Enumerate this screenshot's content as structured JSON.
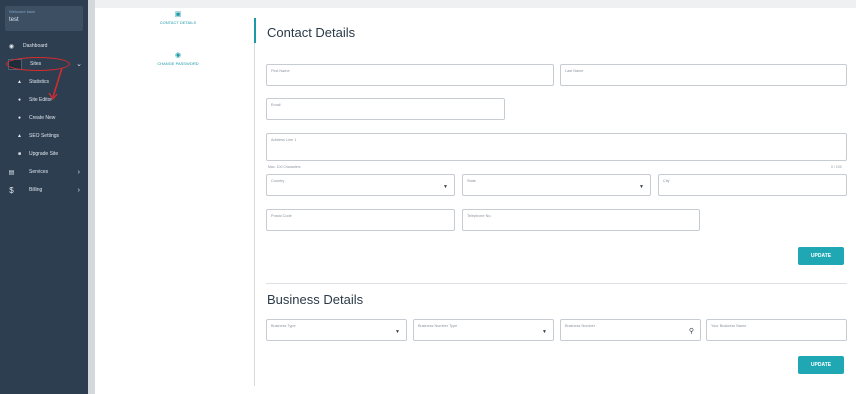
{
  "sidebar": {
    "user_label": "Welcome back",
    "user_name": "test",
    "items": [
      {
        "label": "Dashboard",
        "icon": "palette-icon"
      },
      {
        "label": "Sites",
        "icon": "window-icon"
      },
      {
        "label": "Statistics",
        "icon": "chart-icon"
      },
      {
        "label": "Site Editor",
        "icon": "edit-icon"
      },
      {
        "label": "Create New",
        "icon": "plus-icon"
      },
      {
        "label": "SEO Settings",
        "icon": "seo-icon"
      },
      {
        "label": "Upgrade Site",
        "icon": "upgrade-icon"
      },
      {
        "label": "Services",
        "icon": "server-icon"
      },
      {
        "label": "Billing",
        "icon": "dollar-icon"
      }
    ]
  },
  "tabs": {
    "contact": "CONTACT DETAILS",
    "password": "CHANGE PASSWORD"
  },
  "contact": {
    "title": "Contact Details",
    "first_name": "First Name",
    "last_name": "Last Name",
    "email": "Email",
    "address": "Address Line 1",
    "address_helper": "Max. 100 Characters",
    "address_count": "0 / 100",
    "country": "Country",
    "state": "State",
    "city": "City",
    "postal": "Postal Code",
    "phone": "Telephone No.",
    "update": "UPDATE"
  },
  "business": {
    "title": "Business Details",
    "type": "Business Type",
    "number_type": "Business Number Type",
    "number": "Business Number",
    "name": "Your Business Name",
    "update": "UPDATE"
  },
  "colors": {
    "sidebar": "#2d3e50",
    "accent": "#1fa8b4",
    "annotation": "#d92b2b"
  }
}
